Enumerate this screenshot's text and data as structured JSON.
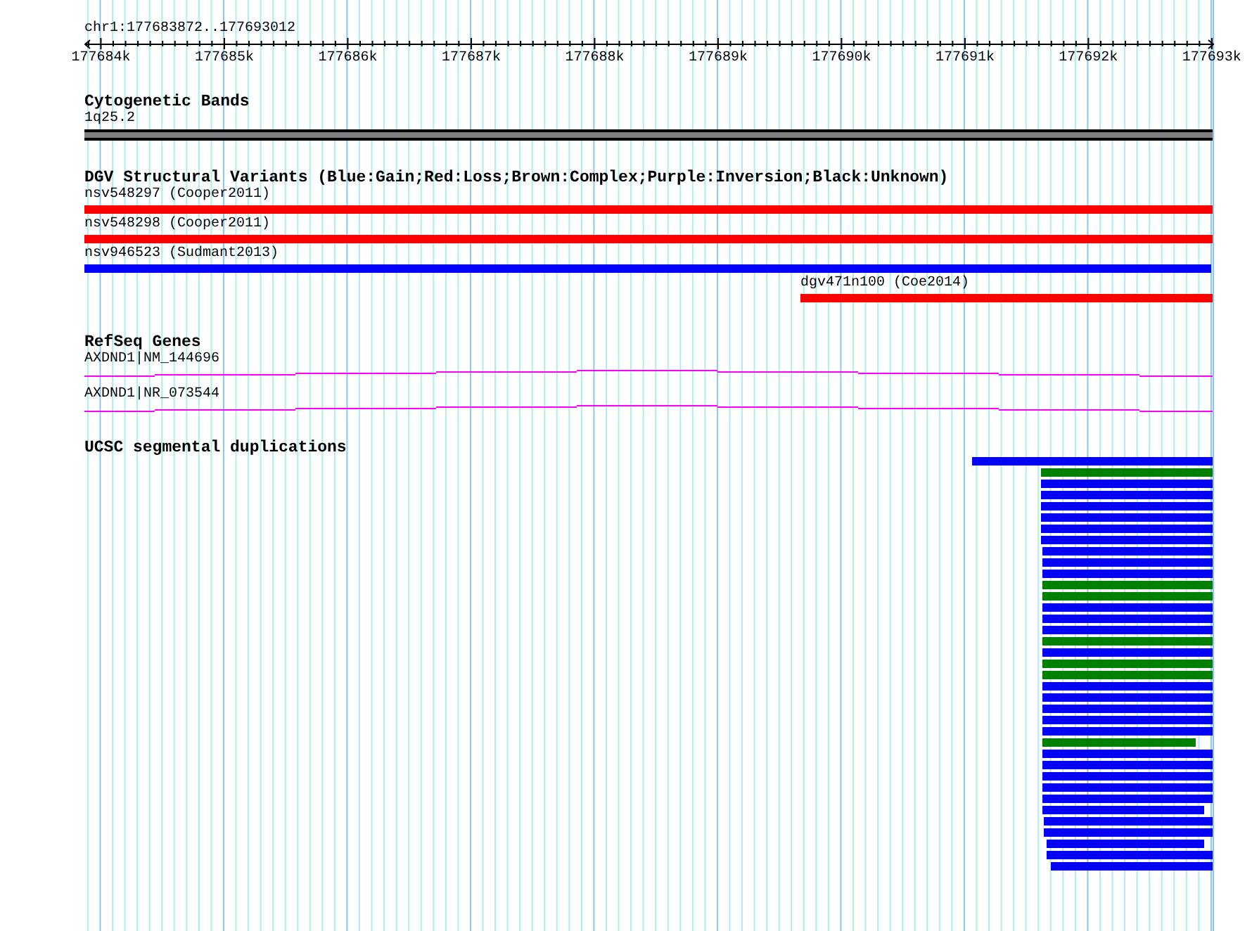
{
  "location": "chr1:177683872..177693012",
  "ruler": {
    "ticks": [
      "177684k",
      "177685k",
      "177686k",
      "177687k",
      "177688k",
      "177689k",
      "177690k",
      "177691k",
      "177692k",
      "177693k"
    ]
  },
  "tracks": [
    {
      "kind": "bands",
      "title": "Cytogenetic Bands",
      "features": [
        {
          "label": "1q25.2"
        }
      ]
    },
    {
      "kind": "variants",
      "title": "DGV Structural Variants (Blue:Gain;Red:Loss;Brown:Complex;Purple:Inversion;Black:Unknown)",
      "features": [
        {
          "label": "nsv548297 (Cooper2011)",
          "color": "#ff0000"
        },
        {
          "label": "nsv548298 (Cooper2011)",
          "color": "#ff0000"
        },
        {
          "label": "nsv946523 (Sudmant2013)",
          "color": "#0000ff"
        },
        {
          "label": "dgv471n100 (Coe2014)",
          "color": "#ff0000"
        }
      ]
    },
    {
      "kind": "genes",
      "title": "RefSeq Genes",
      "features": [
        {
          "label": "AXDND1|NM_144696"
        },
        {
          "label": "AXDND1|NR_073544"
        }
      ]
    },
    {
      "kind": "duplications",
      "title": "UCSC segmental duplications",
      "features": [
        {
          "color": "#0000ff"
        },
        {
          "color": "#008000"
        },
        {
          "color": "#0000ff"
        },
        {
          "color": "#0000ff"
        },
        {
          "color": "#0000ff"
        },
        {
          "color": "#0000ff"
        },
        {
          "color": "#0000ff"
        },
        {
          "color": "#0000ff"
        },
        {
          "color": "#0000ff"
        },
        {
          "color": "#0000ff"
        },
        {
          "color": "#0000ff"
        },
        {
          "color": "#008000"
        },
        {
          "color": "#008000"
        },
        {
          "color": "#0000ff"
        },
        {
          "color": "#0000ff"
        },
        {
          "color": "#0000ff"
        },
        {
          "color": "#008000"
        },
        {
          "color": "#0000ff"
        },
        {
          "color": "#008000"
        },
        {
          "color": "#008000"
        },
        {
          "color": "#0000ff"
        },
        {
          "color": "#0000ff"
        },
        {
          "color": "#0000ff"
        },
        {
          "color": "#0000ff"
        },
        {
          "color": "#0000ff"
        },
        {
          "color": "#008000"
        },
        {
          "color": "#0000ff"
        },
        {
          "color": "#0000ff"
        },
        {
          "color": "#0000ff"
        },
        {
          "color": "#0000ff"
        },
        {
          "color": "#0000ff"
        },
        {
          "color": "#0000ff"
        },
        {
          "color": "#0000ff"
        },
        {
          "color": "#0000ff"
        },
        {
          "color": "#0000ff"
        },
        {
          "color": "#0000ff"
        },
        {
          "color": "#0000ff"
        }
      ]
    }
  ]
}
